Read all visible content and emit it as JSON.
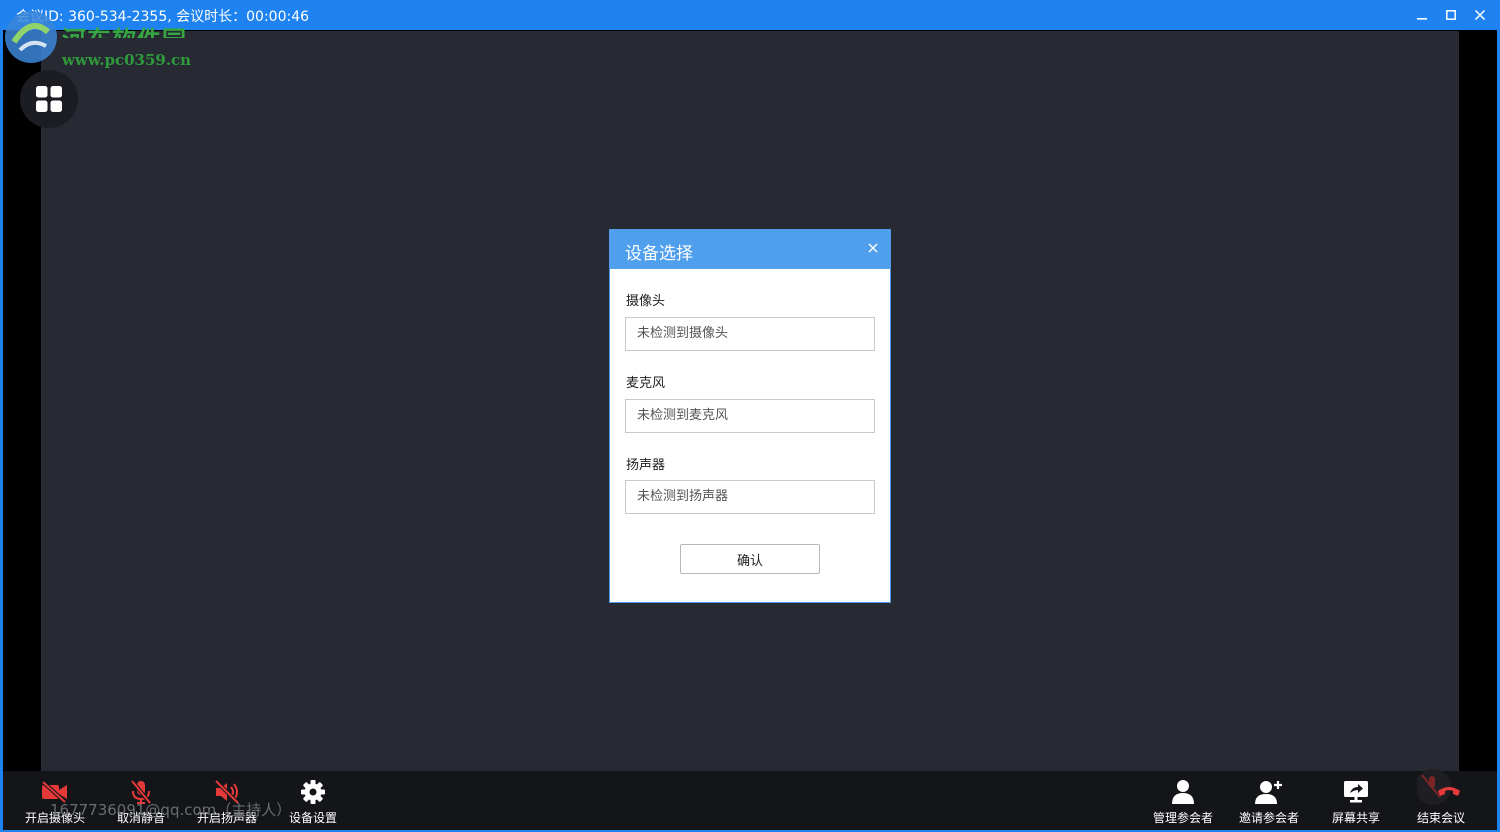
{
  "titlebar": {
    "text": "会议ID: 360-534-2355, 会议时长：00:00:46",
    "minimize_icon": "minimize-icon",
    "maximize_icon": "maximize-icon",
    "close_icon": "close-icon"
  },
  "watermark": {
    "site_cn": "河东软件园",
    "url": "www.pc0359.cn"
  },
  "view_toggle_icon": "grid-icon",
  "dialog": {
    "title": "设备选择",
    "camera_label": "摄像头",
    "camera_value": "未检测到摄像头",
    "mic_label": "麦克风",
    "mic_value": "未检测到麦克风",
    "speaker_label": "扬声器",
    "speaker_value": "未检测到扬声器",
    "confirm": "确认"
  },
  "host_line": "1677736091@qq.com（主持人）",
  "toolbar": {
    "left": [
      {
        "label": "开启摄像头",
        "icon": "camera-off-icon"
      },
      {
        "label": "取消静音",
        "icon": "mic-off-icon"
      },
      {
        "label": "开启扬声器",
        "icon": "speaker-off-icon"
      },
      {
        "label": "设备设置",
        "icon": "gear-icon"
      }
    ],
    "right": [
      {
        "label": "管理参会者",
        "icon": "user-icon"
      },
      {
        "label": "邀请参会者",
        "icon": "user-add-icon"
      },
      {
        "label": "屏幕共享",
        "icon": "screen-share-icon"
      },
      {
        "label": "结束会议",
        "icon": "hangup-icon"
      }
    ]
  },
  "colors": {
    "titlebar": "#1e83f0",
    "stage": "#282a33",
    "dialog_header": "#4f9fec",
    "danger": "#e63a3a"
  }
}
